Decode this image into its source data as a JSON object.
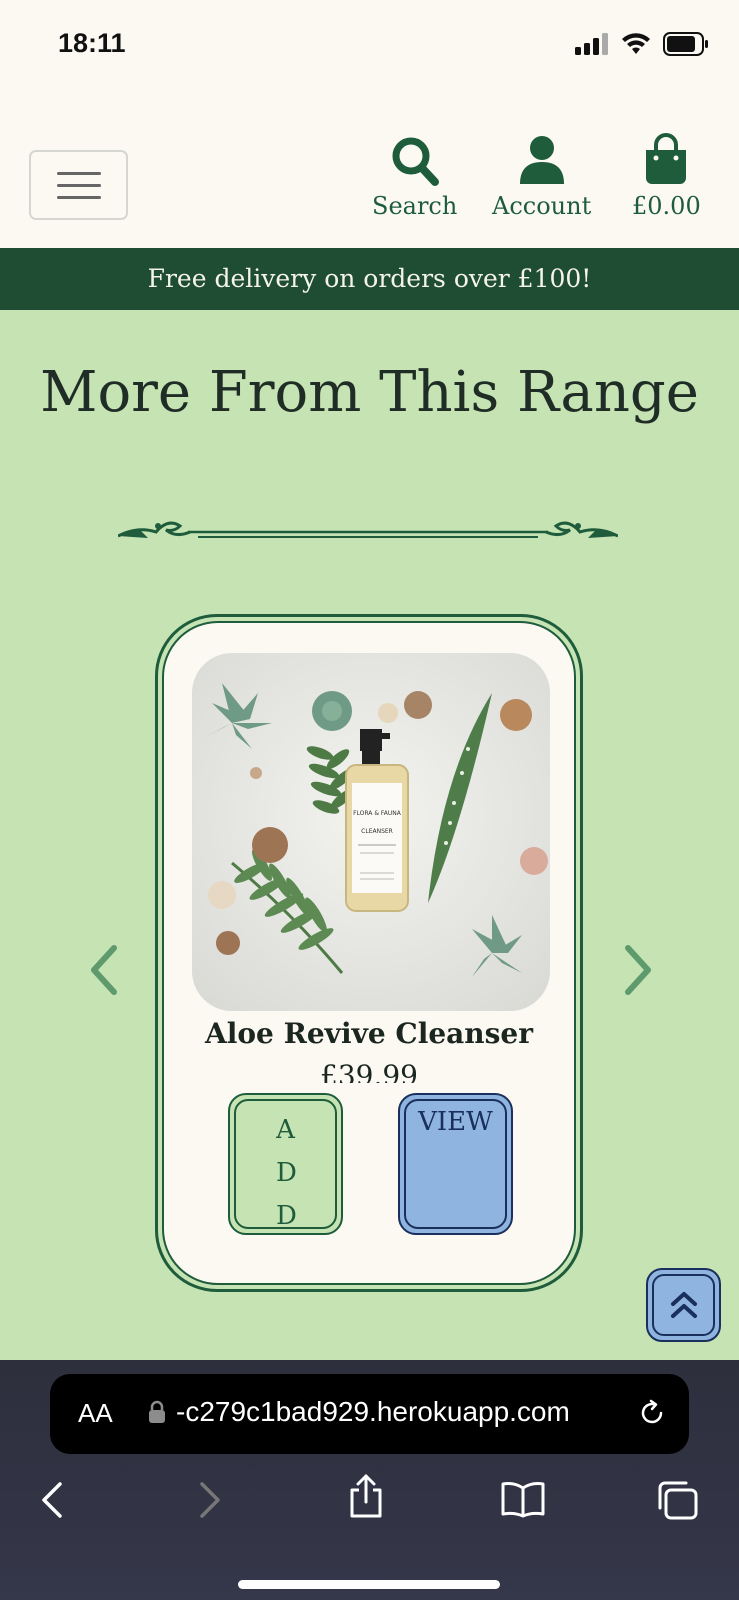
{
  "status_bar": {
    "time": "18:11"
  },
  "header": {
    "menu_icon": "hamburger-icon",
    "nav": [
      {
        "label": "Search",
        "icon": "search-icon"
      },
      {
        "label": "Account",
        "icon": "user-icon"
      },
      {
        "label": "£0.00",
        "icon": "shopping-bag-icon"
      }
    ]
  },
  "banner": {
    "text": "Free delivery on orders over £100!"
  },
  "section": {
    "title": "More From This Range"
  },
  "carousel": {
    "product": {
      "name": "Aloe Revive Cleanser",
      "price": "£39.99",
      "bottle_brand": "FLORA & FAUNA",
      "bottle_label": "CLEANSER"
    },
    "add_label": "ADD",
    "view_label": "VIEW"
  },
  "browser": {
    "text_size_label": "AA",
    "url": "-c279c1bad929.herokuapp.com"
  },
  "colors": {
    "page_bg": "#c5e3b3",
    "cream": "#fbf9f2",
    "dark_green": "#1e4d34",
    "brand_green": "#1e5c3b",
    "view_blue": "#8fb4e0",
    "navy": "#1a2f5c"
  }
}
